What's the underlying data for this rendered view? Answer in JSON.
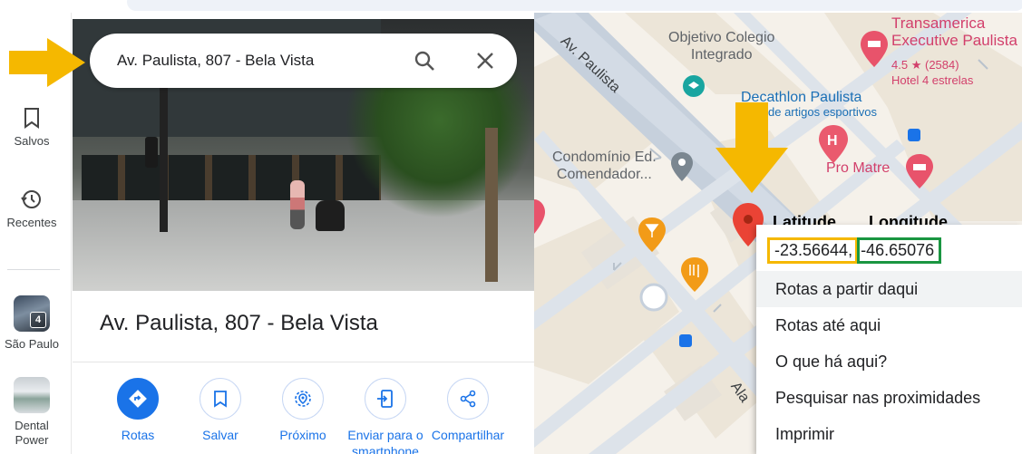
{
  "search": {
    "query": "Av. Paulista, 807 - Bela Vista"
  },
  "rail": {
    "items": [
      {
        "label": "Salvos",
        "icon": "bookmark-icon"
      },
      {
        "label": "Recentes",
        "icon": "history-icon"
      }
    ],
    "recent_places": [
      {
        "label": "São Paulo",
        "badge": "4"
      },
      {
        "label": "Dental Power -..."
      }
    ]
  },
  "place": {
    "title": "Av. Paulista, 807 - Bela Vista",
    "actions": [
      {
        "label": "Rotas",
        "icon": "directions-icon"
      },
      {
        "label": "Salvar",
        "icon": "bookmark-icon"
      },
      {
        "label": "Próximo",
        "icon": "nearby-icon"
      },
      {
        "label": "Enviar para o smartphone",
        "icon": "send-to-phone-icon"
      },
      {
        "label": "Compartilhar",
        "icon": "share-icon"
      }
    ]
  },
  "map": {
    "labels": {
      "street_paulista": "Av. Paulista",
      "school": "Objetivo Colegio\nIntegrado",
      "hotel_name": "Transamerica\nExecutive Paulista",
      "hotel_rating": "4.5",
      "hotel_reviews": "(2584)",
      "hotel_class": "Hotel 4 estrelas",
      "store": "Decathlon Paulista",
      "store_sub": "de artigos esportivos",
      "condo": "Condomínio Ed.\nComendador...",
      "hospital": "Pro Matre",
      "street_al": "Ala"
    }
  },
  "context_menu": {
    "latitude_label": "Latitude",
    "longitude_label": "Longitude",
    "latitude": "-23.56644,",
    "longitude": "-46.65076",
    "items": [
      "Rotas a partir daqui",
      "Rotas até aqui",
      "O que há aqui?",
      "Pesquisar nas proximidades",
      "Imprimir"
    ]
  },
  "colors": {
    "accent": "#1a73e8",
    "annotation_arrow": "#f5b800",
    "latitude_box": "#f5b800",
    "longitude_box": "#1a9641",
    "pin": "#ea4335"
  }
}
